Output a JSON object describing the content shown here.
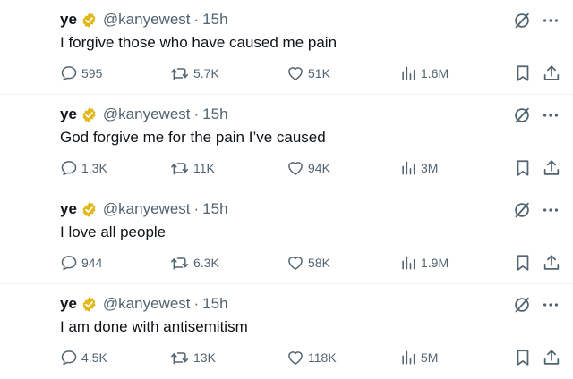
{
  "colors": {
    "text_primary": "#0f1419",
    "text_secondary": "#536471",
    "verified_gold": "#e2b719",
    "divider": "#eff3f4"
  },
  "icons": {
    "verified": "verified-gold-badge-icon",
    "grok": "grok-slash-circle-icon",
    "more": "more-dots-icon",
    "reply": "speech-bubble-icon",
    "retweet": "retweet-arrows-icon",
    "like": "heart-icon",
    "views": "bar-chart-icon",
    "bookmark": "bookmark-icon",
    "share": "share-upload-icon"
  },
  "tweets": [
    {
      "name": "ye",
      "handle": "@kanyewest",
      "separator": "·",
      "time": "15h",
      "text": "I forgive those who have caused me pain",
      "replies": "595",
      "retweets": "5.7K",
      "likes": "51K",
      "views": "1.6M"
    },
    {
      "name": "ye",
      "handle": "@kanyewest",
      "separator": "·",
      "time": "15h",
      "text": "God forgive me for the pain I’ve caused",
      "replies": "1.3K",
      "retweets": "11K",
      "likes": "94K",
      "views": "3M"
    },
    {
      "name": "ye",
      "handle": "@kanyewest",
      "separator": "·",
      "time": "15h",
      "text": "I love all people",
      "replies": "944",
      "retweets": "6.3K",
      "likes": "58K",
      "views": "1.9M"
    },
    {
      "name": "ye",
      "handle": "@kanyewest",
      "separator": "·",
      "time": "15h",
      "text": "I am done with antisemitism",
      "replies": "4.5K",
      "retweets": "13K",
      "likes": "118K",
      "views": "5M"
    }
  ]
}
